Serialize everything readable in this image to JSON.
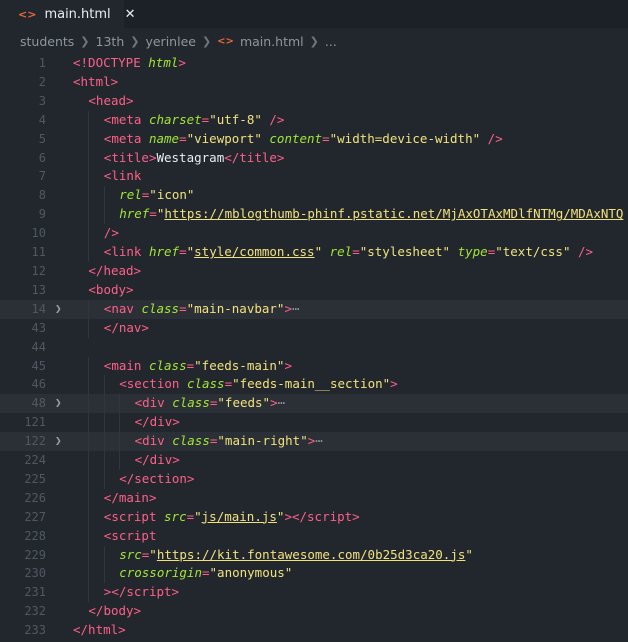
{
  "tab": {
    "filename": "main.html",
    "icon": "html-icon",
    "close": "✕"
  },
  "breadcrumb": [
    "students",
    "13th",
    "yerinlee",
    "main.html",
    "..."
  ],
  "colors": {
    "tag": "#ff5f87",
    "attr": "#a3e635",
    "string": "#f2e27d",
    "bg": "#22272e"
  },
  "lines": [
    {
      "n": "1",
      "indent": 0,
      "fold": false,
      "hl": false,
      "html": "<span class='tg'>&lt;!DOCTYPE</span> <span class='at'>html</span><span class='tg'>&gt;</span>"
    },
    {
      "n": "2",
      "indent": 0,
      "fold": false,
      "hl": false,
      "html": "<span class='tg'>&lt;html&gt;</span>"
    },
    {
      "n": "3",
      "indent": 1,
      "fold": false,
      "hl": false,
      "html": "<span class='tg'>&lt;head&gt;</span>"
    },
    {
      "n": "4",
      "indent": 2,
      "fold": false,
      "hl": false,
      "html": "<span class='tg'>&lt;meta</span> <span class='at'>charset</span><span class='tg'>=</span><span class='st'>\"utf-8\"</span> <span class='tg'>/&gt;</span>"
    },
    {
      "n": "5",
      "indent": 2,
      "fold": false,
      "hl": false,
      "html": "<span class='tg'>&lt;meta</span> <span class='at'>name</span><span class='tg'>=</span><span class='st'>\"viewport\"</span> <span class='at'>content</span><span class='tg'>=</span><span class='st'>\"width=device-width\"</span> <span class='tg'>/&gt;</span>"
    },
    {
      "n": "6",
      "indent": 2,
      "fold": false,
      "hl": false,
      "html": "<span class='tg'>&lt;title&gt;</span><span class='tx'>Westagram</span><span class='tg'>&lt;/title&gt;</span>"
    },
    {
      "n": "7",
      "indent": 2,
      "fold": false,
      "hl": false,
      "html": "<span class='tg'>&lt;link</span>"
    },
    {
      "n": "8",
      "indent": 3,
      "fold": false,
      "hl": false,
      "html": "<span class='at'>rel</span><span class='tg'>=</span><span class='st'>\"icon\"</span>"
    },
    {
      "n": "9",
      "indent": 3,
      "fold": false,
      "hl": false,
      "html": "<span class='at'>href</span><span class='tg'>=</span><span class='st'>\"<span class='ul'>https://mblogthumb-phinf.pstatic.net/MjAxOTAxMDlfNTMg/MDAxNTQ</span></span>"
    },
    {
      "n": "10",
      "indent": 2,
      "fold": false,
      "hl": false,
      "html": "<span class='tg'>/&gt;</span>"
    },
    {
      "n": "11",
      "indent": 2,
      "fold": false,
      "hl": false,
      "html": "<span class='tg'>&lt;link</span> <span class='at'>href</span><span class='tg'>=</span><span class='st'>\"<span class='ul'>style/common.css</span>\"</span> <span class='at'>rel</span><span class='tg'>=</span><span class='st'>\"stylesheet\"</span> <span class='at'>type</span><span class='tg'>=</span><span class='st'>\"text/css\"</span> <span class='tg'>/&gt;</span>"
    },
    {
      "n": "12",
      "indent": 1,
      "fold": false,
      "hl": false,
      "html": "<span class='tg'>&lt;/head&gt;</span>"
    },
    {
      "n": "13",
      "indent": 1,
      "fold": false,
      "hl": false,
      "html": "<span class='tg'>&lt;body&gt;</span>"
    },
    {
      "n": "14",
      "indent": 2,
      "fold": true,
      "hl": true,
      "html": "<span class='tg'>&lt;nav</span> <span class='at'>class</span><span class='tg'>=</span><span class='st'>\"main-navbar\"</span><span class='tg'>&gt;</span><span class='el'>⋯</span>"
    },
    {
      "n": "43",
      "indent": 2,
      "fold": false,
      "hl": false,
      "html": "<span class='tg'>&lt;/nav&gt;</span>"
    },
    {
      "n": "44",
      "indent": 0,
      "fold": false,
      "hl": false,
      "html": ""
    },
    {
      "n": "45",
      "indent": 2,
      "fold": false,
      "hl": false,
      "html": "<span class='tg'>&lt;main</span> <span class='at'>class</span><span class='tg'>=</span><span class='st'>\"feeds-main\"</span><span class='tg'>&gt;</span>"
    },
    {
      "n": "46",
      "indent": 3,
      "fold": false,
      "hl": false,
      "html": "<span class='tg'>&lt;section</span> <span class='at'>class</span><span class='tg'>=</span><span class='st'>\"feeds-main__section\"</span><span class='tg'>&gt;</span>"
    },
    {
      "n": "48",
      "indent": 4,
      "fold": true,
      "hl": true,
      "html": "<span class='tg'>&lt;div</span> <span class='at'>class</span><span class='tg'>=</span><span class='st'>\"feeds\"</span><span class='tg'>&gt;</span><span class='el'>⋯</span>"
    },
    {
      "n": "121",
      "indent": 4,
      "fold": false,
      "hl": false,
      "html": "<span class='tg'>&lt;/div&gt;</span>"
    },
    {
      "n": "122",
      "indent": 4,
      "fold": true,
      "hl": true,
      "html": "<span class='tg'>&lt;div</span> <span class='at'>class</span><span class='tg'>=</span><span class='st'>\"main-right\"</span><span class='tg'>&gt;</span><span class='el'>⋯</span>"
    },
    {
      "n": "224",
      "indent": 4,
      "fold": false,
      "hl": false,
      "html": "<span class='tg'>&lt;/div&gt;</span>"
    },
    {
      "n": "225",
      "indent": 3,
      "fold": false,
      "hl": false,
      "html": "<span class='tg'>&lt;/section&gt;</span>"
    },
    {
      "n": "226",
      "indent": 2,
      "fold": false,
      "hl": false,
      "html": "<span class='tg'>&lt;/main&gt;</span>"
    },
    {
      "n": "227",
      "indent": 2,
      "fold": false,
      "hl": false,
      "html": "<span class='tg'>&lt;script</span> <span class='at'>src</span><span class='tg'>=</span><span class='st'>\"<span class='ul'>js/main.js</span>\"</span><span class='tg'>&gt;&lt;/script&gt;</span>"
    },
    {
      "n": "228",
      "indent": 2,
      "fold": false,
      "hl": false,
      "html": "<span class='tg'>&lt;script</span>"
    },
    {
      "n": "229",
      "indent": 3,
      "fold": false,
      "hl": false,
      "html": "<span class='at'>src</span><span class='tg'>=</span><span class='st'>\"<span class='ul'>https://kit.fontawesome.com/0b25d3ca20.js</span>\"</span>"
    },
    {
      "n": "230",
      "indent": 3,
      "fold": false,
      "hl": false,
      "html": "<span class='at'>crossorigin</span><span class='tg'>=</span><span class='st'>\"anonymous\"</span>"
    },
    {
      "n": "231",
      "indent": 2,
      "fold": false,
      "hl": false,
      "html": "<span class='tg'>&gt;&lt;/script&gt;</span>"
    },
    {
      "n": "232",
      "indent": 1,
      "fold": false,
      "hl": false,
      "html": "<span class='tg'>&lt;/body&gt;</span>"
    },
    {
      "n": "233",
      "indent": 0,
      "fold": false,
      "hl": false,
      "html": "<span class='tg'>&lt;/html&gt;</span>"
    }
  ]
}
